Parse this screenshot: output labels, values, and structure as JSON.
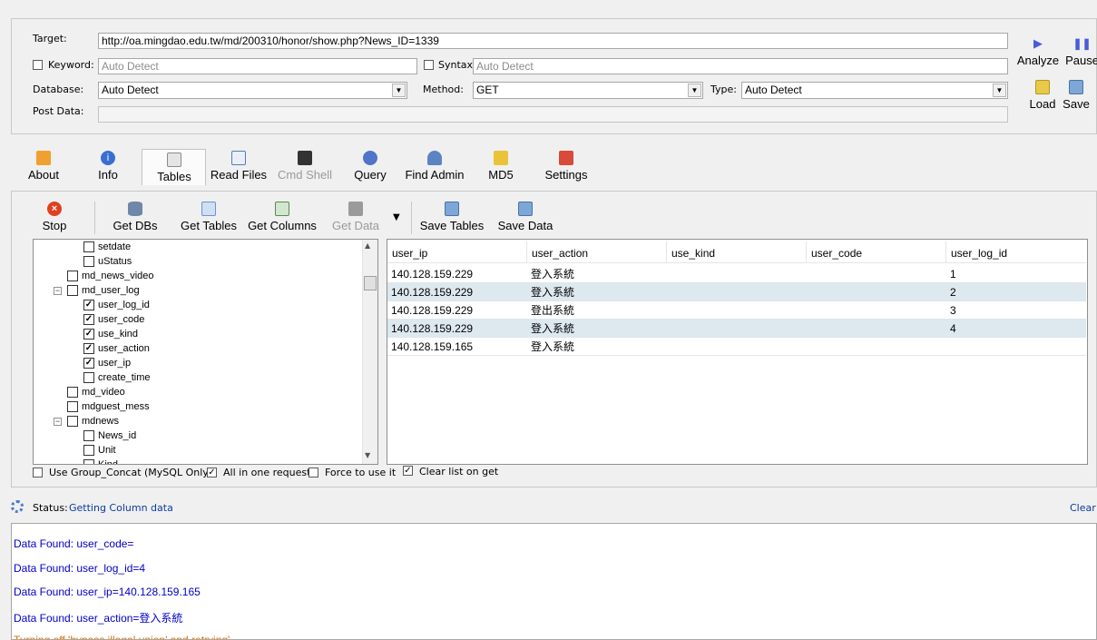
{
  "form": {
    "target_label": "Target:",
    "target_value": "http://oa.mingdao.edu.tw/md/200310/honor/show.php?News_ID=1339",
    "keyword_label": "Keyword:",
    "keyword_placeholder": "Auto Detect",
    "syntax_label": "Syntax:",
    "syntax_placeholder": "Auto Detect",
    "database_label": "Database:",
    "database_value": "Auto Detect",
    "method_label": "Method:",
    "method_value": "GET",
    "type_label": "Type:",
    "type_value": "Auto Detect",
    "postdata_label": "Post Data:"
  },
  "side_actions": {
    "analyze": "Analyze",
    "pause": "Pause",
    "load": "Load",
    "save": "Save"
  },
  "main_tabs": [
    {
      "label": "About",
      "icon": "carrot-icon"
    },
    {
      "label": "Info",
      "icon": "info-icon"
    },
    {
      "label": "Tables",
      "icon": "table-icon",
      "selected": true
    },
    {
      "label": "Read Files",
      "icon": "file-icon"
    },
    {
      "label": "Cmd Shell",
      "icon": "terminal-icon",
      "disabled": true
    },
    {
      "label": "Query",
      "icon": "query-icon"
    },
    {
      "label": "Find Admin",
      "icon": "users-icon"
    },
    {
      "label": "MD5",
      "icon": "key-icon"
    },
    {
      "label": "Settings",
      "icon": "tools-icon"
    }
  ],
  "toolbar": {
    "stop": "Stop",
    "get_dbs": "Get DBs",
    "get_tables": "Get Tables",
    "get_columns": "Get Columns",
    "get_data": "Get Data",
    "save_tables": "Save Tables",
    "save_data": "Save Data"
  },
  "tree": [
    {
      "label": "setdate",
      "level": 2,
      "checked": false
    },
    {
      "label": "uStatus",
      "level": 2,
      "checked": false
    },
    {
      "label": "md_news_video",
      "level": 1,
      "checked": false
    },
    {
      "label": "md_user_log",
      "level": 1,
      "checked": false,
      "expanded": true
    },
    {
      "label": "user_log_id",
      "level": 2,
      "checked": true
    },
    {
      "label": "user_code",
      "level": 2,
      "checked": true
    },
    {
      "label": "use_kind",
      "level": 2,
      "checked": true
    },
    {
      "label": "user_action",
      "level": 2,
      "checked": true
    },
    {
      "label": "user_ip",
      "level": 2,
      "checked": true
    },
    {
      "label": "create_time",
      "level": 2,
      "checked": false
    },
    {
      "label": "md_video",
      "level": 1,
      "checked": false
    },
    {
      "label": "mdguest_mess",
      "level": 1,
      "checked": false
    },
    {
      "label": "mdnews",
      "level": 1,
      "checked": false,
      "expanded": true
    },
    {
      "label": "News_id",
      "level": 2,
      "checked": false
    },
    {
      "label": "Unit",
      "level": 2,
      "checked": false
    },
    {
      "label": "Kind",
      "level": 2,
      "checked": false
    }
  ],
  "grid": {
    "columns": [
      "user_ip",
      "user_action",
      "use_kind",
      "user_code",
      "user_log_id"
    ],
    "rows": [
      [
        "140.128.159.229",
        "登入系統",
        "",
        "",
        "1"
      ],
      [
        "140.128.159.229",
        "登入系統",
        "",
        "",
        "2"
      ],
      [
        "140.128.159.229",
        "登出系統",
        "",
        "",
        "3"
      ],
      [
        "140.128.159.229",
        "登入系統",
        "",
        "",
        "4"
      ],
      [
        "140.128.159.165",
        "登入系統",
        "",
        "",
        ""
      ]
    ]
  },
  "options": {
    "group_concat": "Use Group_Concat (MySQL Only)",
    "all_in_one": "All in one request.",
    "force": "Force to use it",
    "clear_list": "Clear list on get"
  },
  "status": {
    "label": "Status:",
    "value": "Getting Column data",
    "clear": "Clear L"
  },
  "log": [
    {
      "text": "Data Found: user_code=",
      "color": "#0000c8"
    },
    {
      "text": "Data Found: user_log_id=4",
      "color": "#0000c8"
    },
    {
      "text": "Data Found: user_ip=140.128.159.165",
      "color": "#0000c8"
    },
    {
      "text": "Data Found: user_action=登入系統",
      "color": "#0000c8"
    },
    {
      "text": "Turning off 'bypass illegal union' and retrying'",
      "color": "#e07000"
    }
  ]
}
